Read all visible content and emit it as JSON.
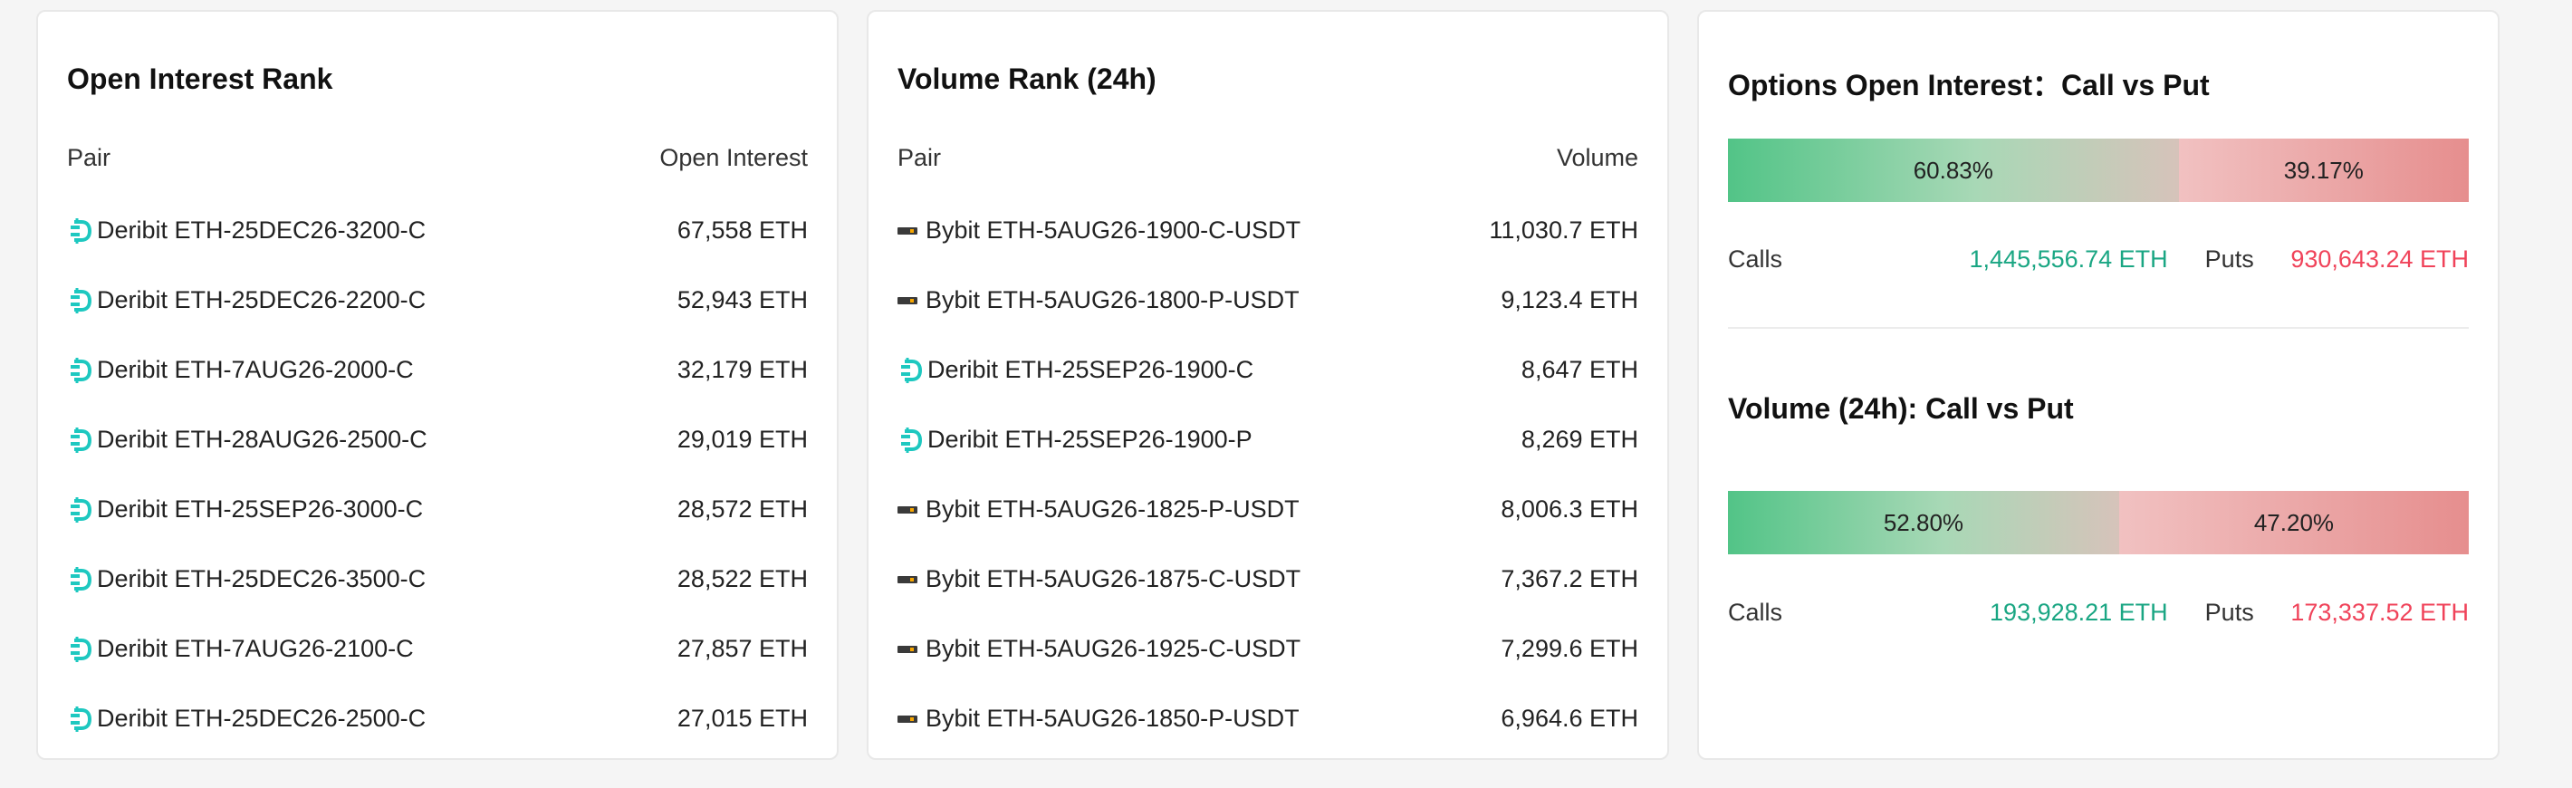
{
  "open_interest_rank": {
    "title": "Open Interest Rank",
    "col_pair": "Pair",
    "col_value": "Open Interest",
    "rows": [
      {
        "exchange_icon": "deribit-icon",
        "pair": "Deribit ETH-25DEC26-3200-C",
        "value": "67,558 ETH"
      },
      {
        "exchange_icon": "deribit-icon",
        "pair": "Deribit ETH-25DEC26-2200-C",
        "value": "52,943 ETH"
      },
      {
        "exchange_icon": "deribit-icon",
        "pair": "Deribit ETH-7AUG26-2000-C",
        "value": "32,179 ETH"
      },
      {
        "exchange_icon": "deribit-icon",
        "pair": "Deribit ETH-28AUG26-2500-C",
        "value": "29,019 ETH"
      },
      {
        "exchange_icon": "deribit-icon",
        "pair": "Deribit ETH-25SEP26-3000-C",
        "value": "28,572 ETH"
      },
      {
        "exchange_icon": "deribit-icon",
        "pair": "Deribit ETH-25DEC26-3500-C",
        "value": "28,522 ETH"
      },
      {
        "exchange_icon": "deribit-icon",
        "pair": "Deribit ETH-7AUG26-2100-C",
        "value": "27,857 ETH"
      },
      {
        "exchange_icon": "deribit-icon",
        "pair": "Deribit ETH-25DEC26-2500-C",
        "value": "27,015 ETH"
      }
    ]
  },
  "volume_rank": {
    "title": "Volume Rank (24h)",
    "col_pair": "Pair",
    "col_value": "Volume",
    "rows": [
      {
        "exchange_icon": "bybit-icon",
        "pair": "Bybit ETH-5AUG26-1900-C-USDT",
        "value": "11,030.7 ETH"
      },
      {
        "exchange_icon": "bybit-icon",
        "pair": "Bybit ETH-5AUG26-1800-P-USDT",
        "value": "9,123.4 ETH"
      },
      {
        "exchange_icon": "deribit-icon",
        "pair": "Deribit ETH-25SEP26-1900-C",
        "value": "8,647 ETH"
      },
      {
        "exchange_icon": "deribit-icon",
        "pair": "Deribit ETH-25SEP26-1900-P",
        "value": "8,269 ETH"
      },
      {
        "exchange_icon": "bybit-icon",
        "pair": "Bybit ETH-5AUG26-1825-P-USDT",
        "value": "8,006.3 ETH"
      },
      {
        "exchange_icon": "bybit-icon",
        "pair": "Bybit ETH-5AUG26-1875-C-USDT",
        "value": "7,367.2 ETH"
      },
      {
        "exchange_icon": "bybit-icon",
        "pair": "Bybit ETH-5AUG26-1925-C-USDT",
        "value": "7,299.6 ETH"
      },
      {
        "exchange_icon": "bybit-icon",
        "pair": "Bybit ETH-5AUG26-1850-P-USDT",
        "value": "6,964.6 ETH"
      }
    ]
  },
  "call_vs_put": {
    "oi_title": "Options Open Interest：Call vs Put",
    "oi_call_pct": "60.83%",
    "oi_put_pct": "39.17%",
    "oi_call_fraction": 0.6083,
    "oi_calls_label": "Calls",
    "oi_calls_value": "1,445,556.74 ETH",
    "oi_puts_label": "Puts",
    "oi_puts_value": "930,643.24 ETH",
    "vol_title": "Volume (24h): Call vs Put",
    "vol_call_pct": "52.80%",
    "vol_put_pct": "47.20%",
    "vol_call_fraction": 0.528,
    "vol_calls_label": "Calls",
    "vol_calls_value": "193,928.21 ETH",
    "vol_puts_label": "Puts",
    "vol_puts_value": "173,337.52 ETH"
  },
  "colors": {
    "deribit": "#1ec8c0",
    "call_green": "#1aa683",
    "put_red": "#f0435a"
  }
}
